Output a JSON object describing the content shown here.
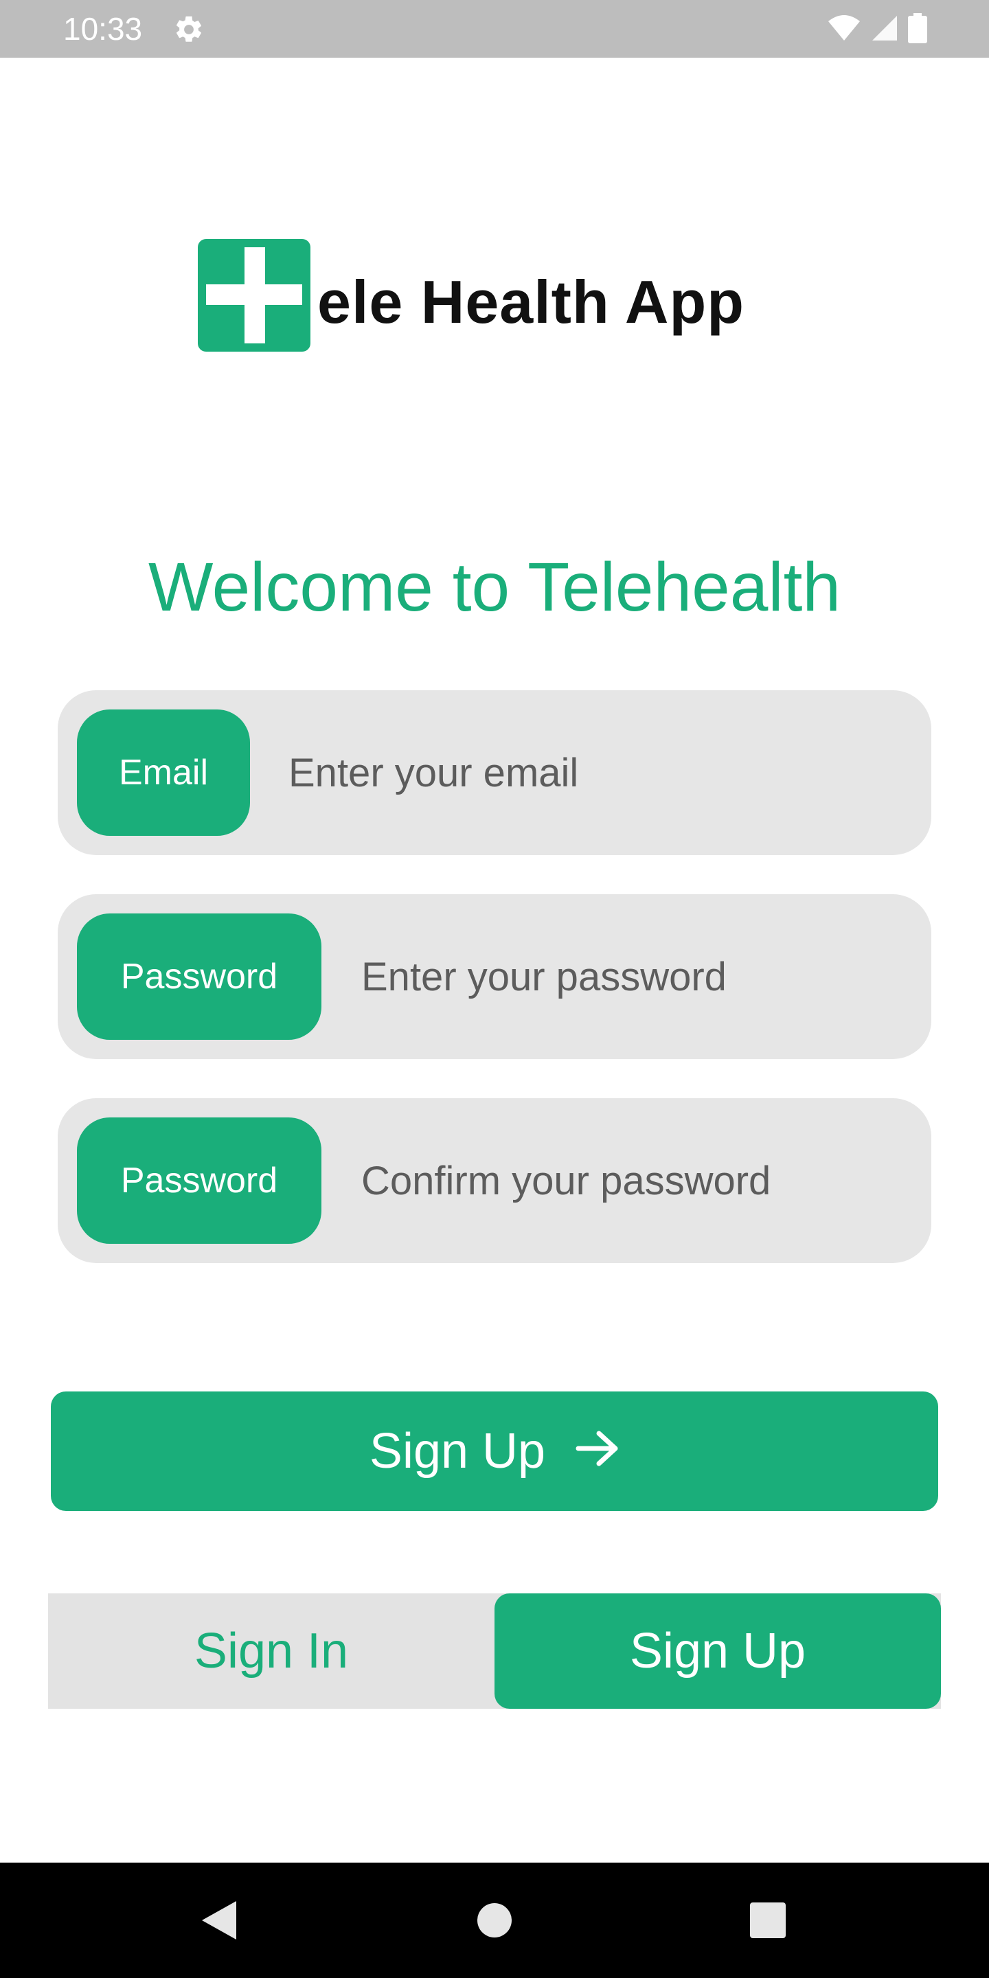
{
  "status_bar": {
    "time": "10:33",
    "icons": [
      "gear-icon",
      "wifi-icon",
      "signal-icon",
      "battery-icon"
    ]
  },
  "logo": {
    "text": "ele Health App",
    "icon": "medical-cross-icon"
  },
  "welcome_title": "Welcome to Telehealth",
  "form": {
    "email": {
      "label": "Email",
      "placeholder": "Enter your email"
    },
    "password": {
      "label": "Password",
      "placeholder": "Enter your password"
    },
    "confirm_password": {
      "label": "Password",
      "placeholder": "Confirm your password"
    }
  },
  "submit_button": {
    "label": "Sign Up",
    "icon": "arrow-right-icon"
  },
  "mode_toggle": {
    "sign_in": "Sign In",
    "sign_up": "Sign Up",
    "active": "Sign Up"
  },
  "nav_bar": {
    "icons": [
      "back-icon",
      "home-icon",
      "recents-icon"
    ]
  },
  "colors": {
    "accent": "#1aae7a",
    "field_background": "#e6e6e6",
    "status_bar": "#bdbdbd"
  }
}
